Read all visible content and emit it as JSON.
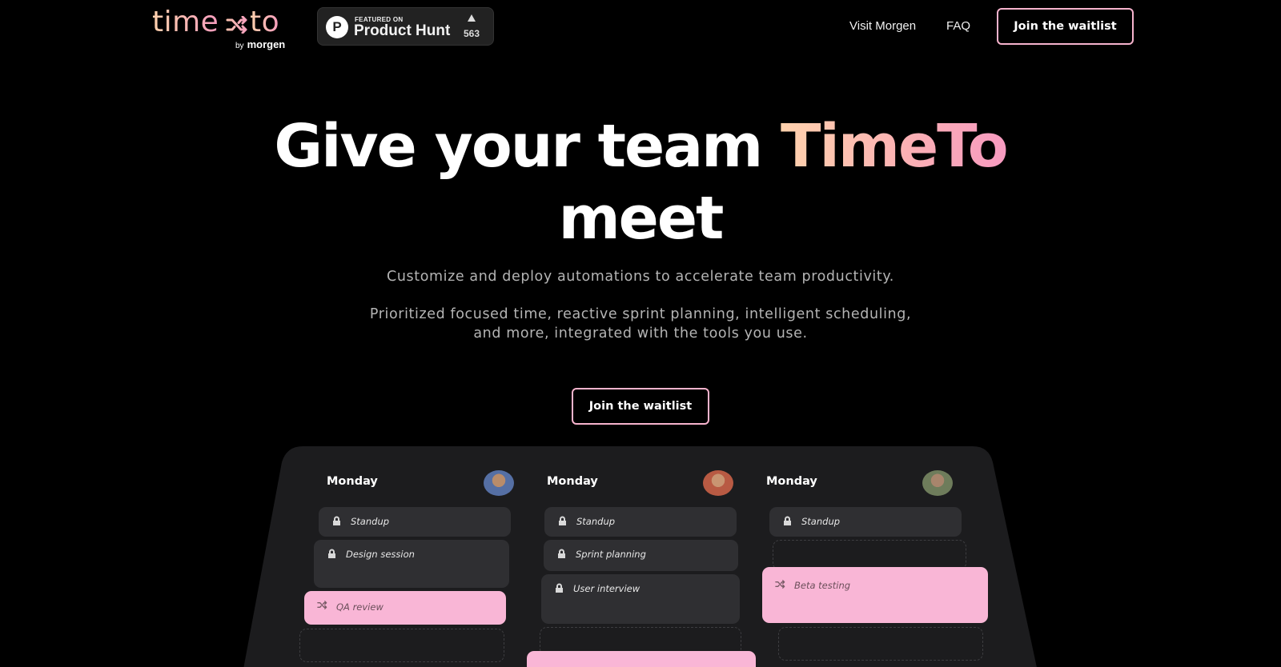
{
  "header": {
    "logo": {
      "word_left": "time",
      "word_right": "to",
      "by_small": "by",
      "by_brand": "morgen"
    },
    "product_hunt": {
      "featured_label": "FEATURED ON",
      "name": "Product Hunt",
      "upvotes": "563"
    },
    "nav": [
      {
        "label": "Visit Morgen"
      },
      {
        "label": "FAQ"
      }
    ],
    "cta_label": "Join the waitlist"
  },
  "hero": {
    "title_part1": "Give your team ",
    "title_brand": "TimeTo",
    "title_part2": "meet",
    "subtitle1": "Customize and deploy automations to accelerate team productivity.",
    "subtitle2": "Prioritized focused time, reactive sprint planning, intelligent scheduling, and more, integrated with the tools you use.",
    "cta_label": "Join the waitlist"
  },
  "preview": {
    "columns": [
      {
        "day": "Monday",
        "cards": [
          "Standup",
          "Design session",
          "QA review"
        ]
      },
      {
        "day": "Monday",
        "cards": [
          "Standup",
          "Sprint planning",
          "User interview"
        ]
      },
      {
        "day": "Monday",
        "cards": [
          "Standup",
          "Beta testing"
        ]
      }
    ]
  },
  "colors": {
    "accent_pink": "#f9b6d6",
    "accent_peach": "#ffd2ad",
    "background": "#000000",
    "card": "#2f2f32"
  },
  "icons": [
    "shuffle-icon",
    "lock-icon",
    "upvote-arrow-icon",
    "product-hunt-logo"
  ]
}
